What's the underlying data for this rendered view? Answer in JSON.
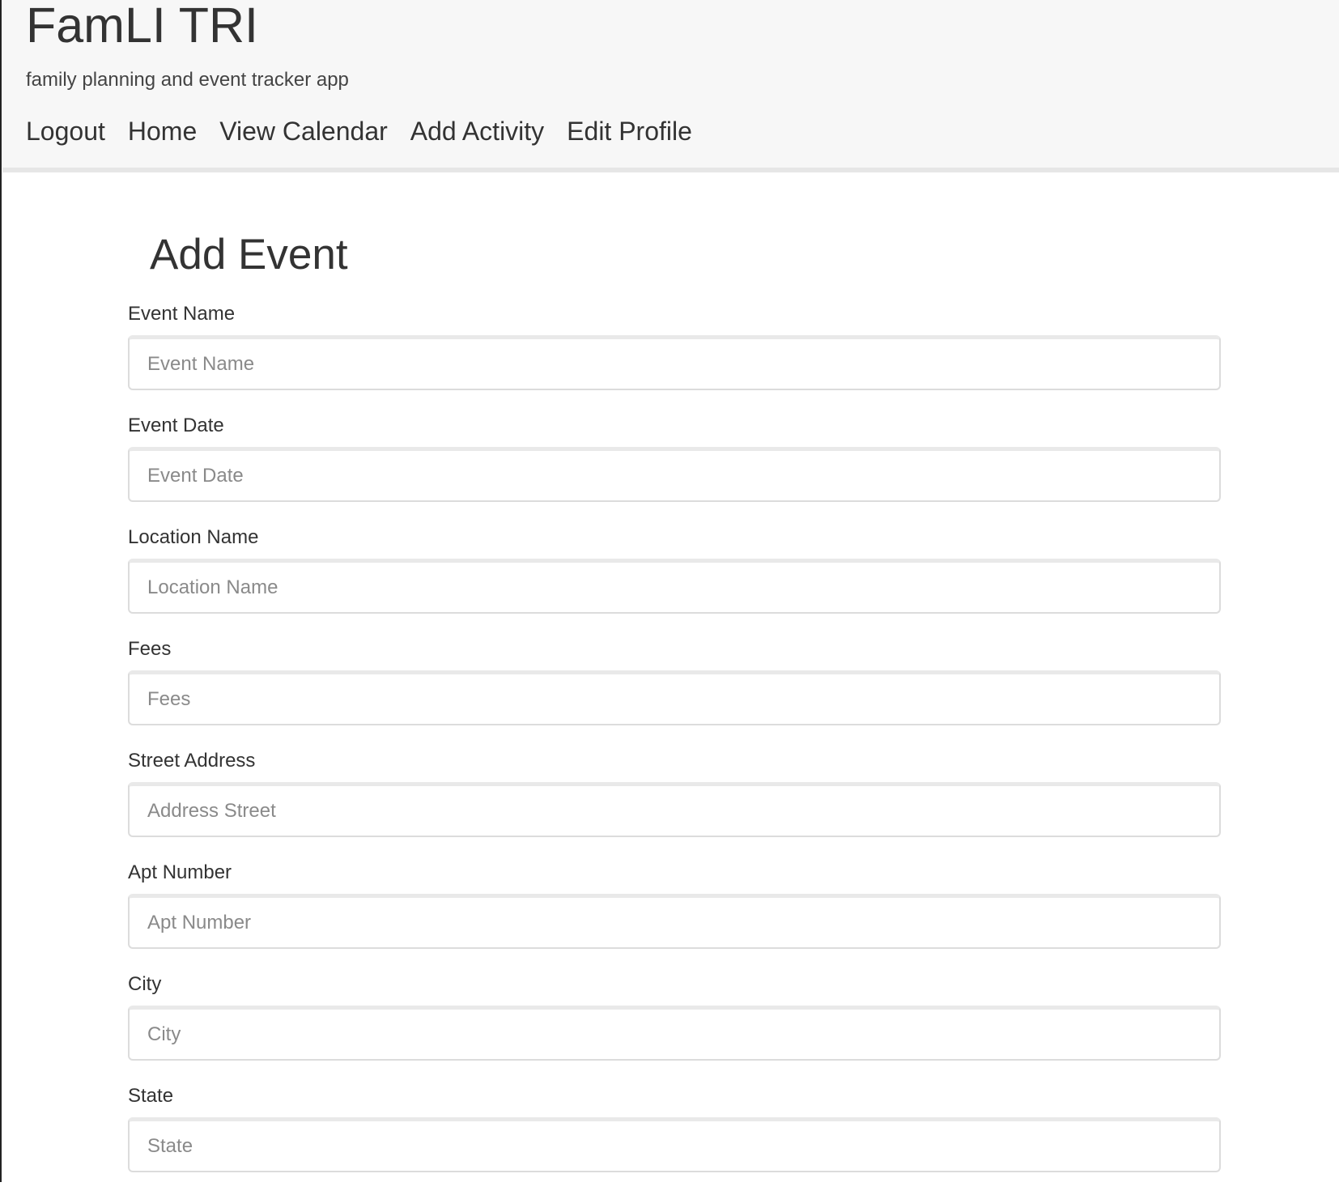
{
  "header": {
    "title": "FamLI TRI",
    "tagline": "family planning and event tracker app",
    "nav": [
      {
        "label": "Logout"
      },
      {
        "label": "Home"
      },
      {
        "label": "View Calendar"
      },
      {
        "label": "Add Activity"
      },
      {
        "label": "Edit Profile"
      }
    ]
  },
  "form": {
    "title": "Add Event",
    "fields": [
      {
        "label": "Event Name",
        "placeholder": "Event Name",
        "value": ""
      },
      {
        "label": "Event Date",
        "placeholder": "Event Date",
        "value": ""
      },
      {
        "label": "Location Name",
        "placeholder": "Location Name",
        "value": ""
      },
      {
        "label": "Fees",
        "placeholder": "Fees",
        "value": ""
      },
      {
        "label": "Street Address",
        "placeholder": "Address Street",
        "value": ""
      },
      {
        "label": "Apt Number",
        "placeholder": "Apt Number",
        "value": ""
      },
      {
        "label": "City",
        "placeholder": "City",
        "value": ""
      },
      {
        "label": "State",
        "placeholder": "State",
        "value": ""
      }
    ]
  },
  "colors": {
    "header_bg": "#f7f7f7",
    "text": "#333333",
    "placeholder": "#8a8a8a",
    "input_border": "#dcdcdc"
  }
}
